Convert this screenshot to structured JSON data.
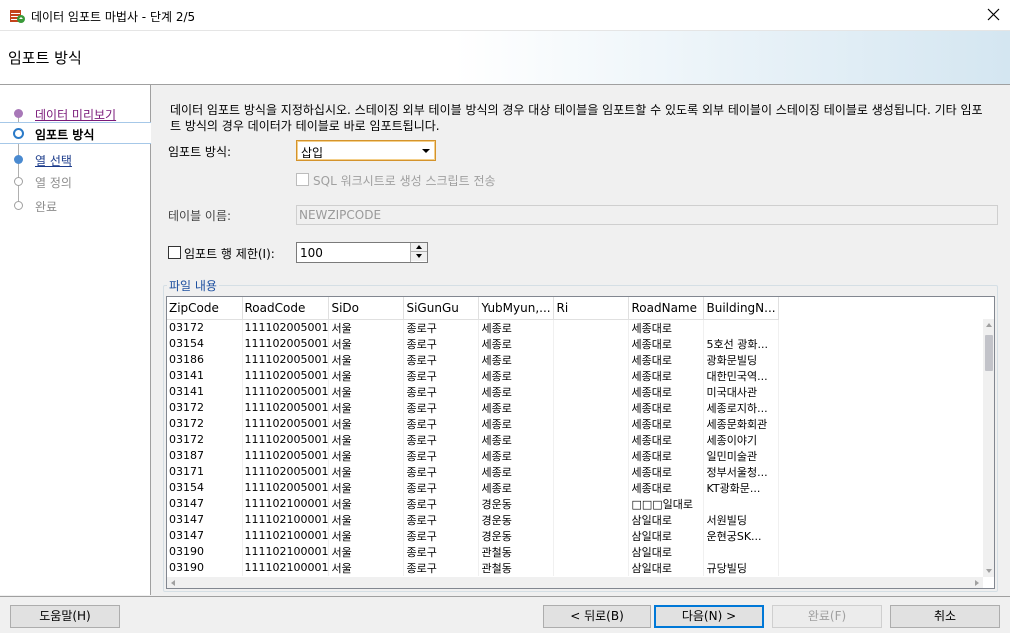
{
  "window": {
    "title": "데이터 임포트 마법사 - 단계 2/5"
  },
  "header": {
    "title": "임포트 방식"
  },
  "nav": {
    "items": [
      {
        "label": "데이터 미리보기",
        "state": "done"
      },
      {
        "label": "임포트 방식",
        "state": "active"
      },
      {
        "label": "열 선택",
        "state": "next"
      },
      {
        "label": "열 정의",
        "state": "disabled"
      },
      {
        "label": "완료",
        "state": "disabled"
      }
    ]
  },
  "main": {
    "description": "데이터 임포트 방식을 지정하십시오. 스테이징 외부 테이블 방식의 경우 대상 테이블을 임포트할 수 있도록 외부 테이블이 스테이징 테이블로 생성됩니다. 기타 임포트 방식의 경우 데이터가 테이블로 바로 임포트됩니다.",
    "import_method_label": "임포트 방식:",
    "import_method_value": "삽입",
    "sql_script_label": "SQL 워크시트로 생성 스크립트 전송",
    "table_name_label": "테이블 이름:",
    "table_name_value": "NEWZIPCODE",
    "row_limit_label": "임포트 행 제한(I):",
    "row_limit_value": "100",
    "file_contents_label": "파일 내용"
  },
  "grid": {
    "columns": [
      "ZipCode",
      "RoadCode",
      "SiDo",
      "SiGunGu",
      "YubMyun,...",
      "Ri",
      "RoadName",
      "BuildingN..."
    ],
    "rows": [
      [
        "03172",
        "111102005001",
        "서울",
        "종로구",
        "세종로",
        "",
        "세종대로",
        ""
      ],
      [
        "03154",
        "111102005001",
        "서울",
        "종로구",
        "세종로",
        "",
        "세종대로",
        "5호선 광화..."
      ],
      [
        "03186",
        "111102005001",
        "서울",
        "종로구",
        "세종로",
        "",
        "세종대로",
        "광화문빌딩"
      ],
      [
        "03141",
        "111102005001",
        "서울",
        "종로구",
        "세종로",
        "",
        "세종대로",
        "대한민국역..."
      ],
      [
        "03141",
        "111102005001",
        "서울",
        "종로구",
        "세종로",
        "",
        "세종대로",
        "미국대사관"
      ],
      [
        "03172",
        "111102005001",
        "서울",
        "종로구",
        "세종로",
        "",
        "세종대로",
        "세종로지하..."
      ],
      [
        "03172",
        "111102005001",
        "서울",
        "종로구",
        "세종로",
        "",
        "세종대로",
        "세종문화회관"
      ],
      [
        "03172",
        "111102005001",
        "서울",
        "종로구",
        "세종로",
        "",
        "세종대로",
        "세종이야기"
      ],
      [
        "03187",
        "111102005001",
        "서울",
        "종로구",
        "세종로",
        "",
        "세종대로",
        "일민미술관"
      ],
      [
        "03171",
        "111102005001",
        "서울",
        "종로구",
        "세종로",
        "",
        "세종대로",
        "정부서울청..."
      ],
      [
        "03154",
        "111102005001",
        "서울",
        "종로구",
        "세종로",
        "",
        "세종대로",
        "KT광화문..."
      ],
      [
        "03147",
        "111102100001",
        "서울",
        "종로구",
        "경운동",
        "",
        "□□□일대로",
        ""
      ],
      [
        "03147",
        "111102100001",
        "서울",
        "종로구",
        "경운동",
        "",
        "삼일대로",
        "서원빌딩"
      ],
      [
        "03147",
        "111102100001",
        "서울",
        "종로구",
        "경운동",
        "",
        "삼일대로",
        "운현궁SK..."
      ],
      [
        "03190",
        "111102100001",
        "서울",
        "종로구",
        "관철동",
        "",
        "삼일대로",
        ""
      ],
      [
        "03190",
        "111102100001",
        "서울",
        "종로구",
        "관철동",
        "",
        "삼일대로",
        "규당빌딩"
      ]
    ]
  },
  "footer": {
    "help_label": "도움말(H)",
    "back_label": "< 뒤로(B)",
    "next_label": "다음(N) >",
    "finish_label": "완료(F)",
    "cancel_label": "취소"
  }
}
